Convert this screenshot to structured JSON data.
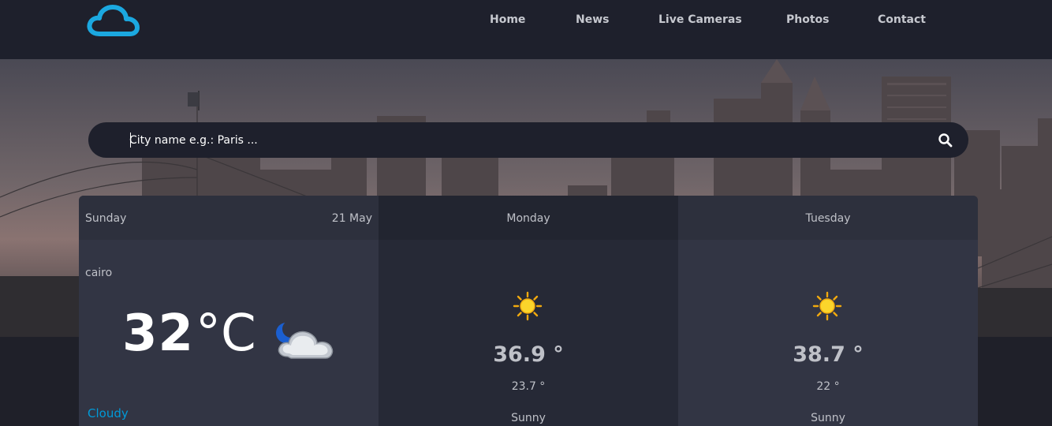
{
  "nav": {
    "logo_icon": "cloud-logo-icon",
    "links": [
      "Home",
      "News",
      "Live Cameras",
      "Photos",
      "Contact"
    ]
  },
  "search": {
    "placeholder": "City name e.g.: Paris ...",
    "value": "",
    "icon": "search-icon"
  },
  "forecast": {
    "today": {
      "day": "Sunday",
      "date": "21 May",
      "city": "cairo",
      "temp": "32",
      "unit": "°C",
      "condition": "Cloudy",
      "icon": "cloudy-night-icon"
    },
    "days": [
      {
        "day": "Monday",
        "max": "36.9 °",
        "min": "23.7 °",
        "condition": "Sunny",
        "icon": "sun-icon"
      },
      {
        "day": "Tuesday",
        "max": "38.7 °",
        "min": "22 °",
        "condition": "Sunny",
        "icon": "sun-icon"
      }
    ]
  },
  "colors": {
    "nav_bg": "#1e202c",
    "card_light": "#323544",
    "card_dark": "#262936",
    "accent": "#009ad8",
    "sun": "#f7c523"
  }
}
